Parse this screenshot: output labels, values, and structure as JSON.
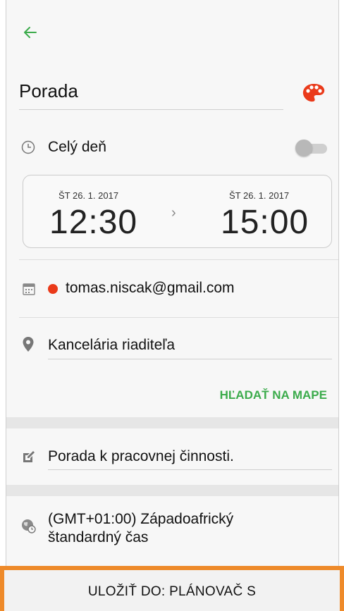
{
  "header": {
    "back_icon": "arrow-left-icon",
    "accent_color": "#3bab4b"
  },
  "event": {
    "title": "Porada",
    "color_icon": "palette-icon",
    "color": "#ea3a1a",
    "all_day_label": "Celý deň",
    "all_day_enabled": false
  },
  "time": {
    "start_date": "ŠT 26. 1. 2017",
    "start_time": "12:30",
    "end_date": "ŠT 26. 1. 2017",
    "end_time": "15:00"
  },
  "calendar": {
    "account": "tomas.niscak@gmail.com",
    "color": "#ea3a1a"
  },
  "location": {
    "value": "Kancelária riaditeľa",
    "map_button": "HĽADAŤ NA MAPE"
  },
  "notes": {
    "value": "Porada k pracovnej činnosti."
  },
  "timezone": {
    "line1": "(GMT+01:00) Západoafrický",
    "line2": "štandardný čas"
  },
  "footer": {
    "save_label": "ULOŽIŤ DO: PLÁNOVAČ S",
    "border_color": "#ee8a2a"
  }
}
